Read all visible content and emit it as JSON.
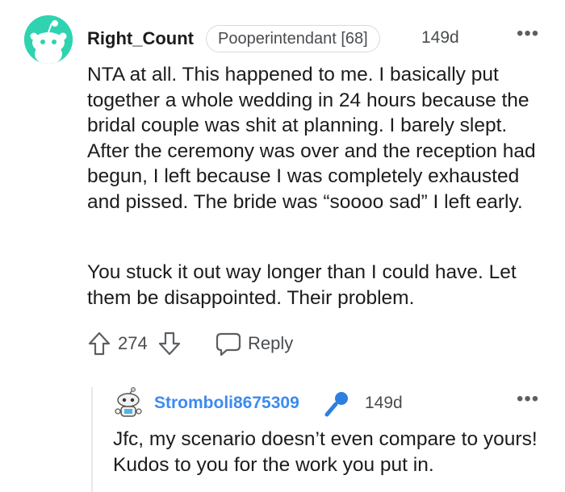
{
  "comment": {
    "author": "Right_Count",
    "flair": "Pooperintendant [68]",
    "age": "149d",
    "more": "•••",
    "paragraphs": [
      "NTA at all. This happened to me. I basically put together a whole wedding in 24 hours because the bridal couple was shit at planning. I barely slept. After the ceremony was over and the reception had begun, I left because I was completely exhausted and pissed. The bride was “soooo sad” I left early.",
      "You stuck it out way longer than I could have. Let them be disappointed. Their problem."
    ],
    "score": "274",
    "reply_label": "Reply",
    "avatar_color": "#2fd3b0"
  },
  "reply": {
    "author": "Stromboli8675309",
    "age": "149d",
    "more": "•••",
    "text": "Jfc, my scenario doesn’t even compare to yours! Kudos to you for the work you put in.",
    "author_color": "#3d8af0",
    "badge_icon": "microphone-icon"
  }
}
